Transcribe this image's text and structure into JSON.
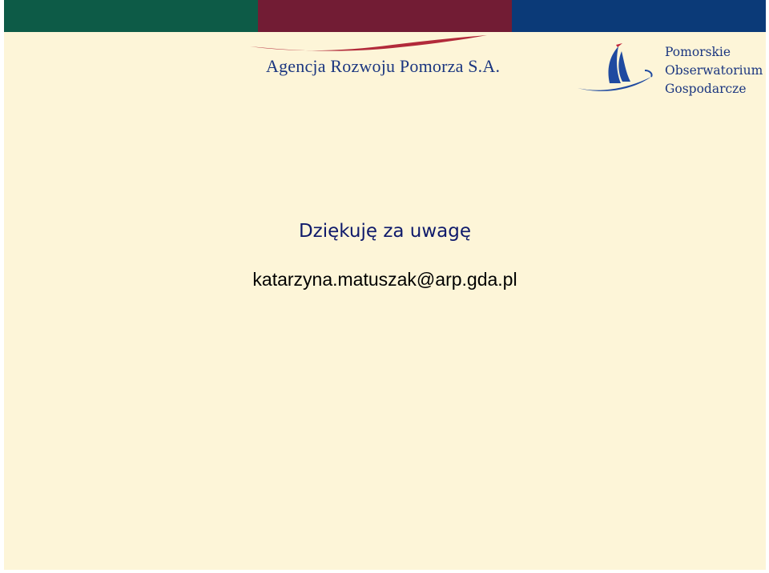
{
  "colors": {
    "background": "#fdf5d8",
    "stripe_green": "#0d5b47",
    "stripe_maroon": "#721c34",
    "stripe_navy": "#0b3a78",
    "arp_text": "#1b3680",
    "arp_swoosh": "#b22a3a",
    "pog_text": "#1b3680",
    "pog_sail": "#1f4aa0",
    "thanks_text": "#0f1a6b",
    "email_text": "#000000"
  },
  "header": {
    "logo_left": {
      "icon": "arp-swoosh-logo",
      "text": "Agencja Rozwoju Pomorza S.A."
    },
    "logo_right": {
      "icon": "sailboat-logo",
      "lines": [
        "Pomorskie",
        "Obserwatorium",
        "Gospodarcze"
      ]
    }
  },
  "content": {
    "thanks": "Dziękuję za uwagę",
    "email": "katarzyna.matuszak@arp.gda.pl"
  }
}
